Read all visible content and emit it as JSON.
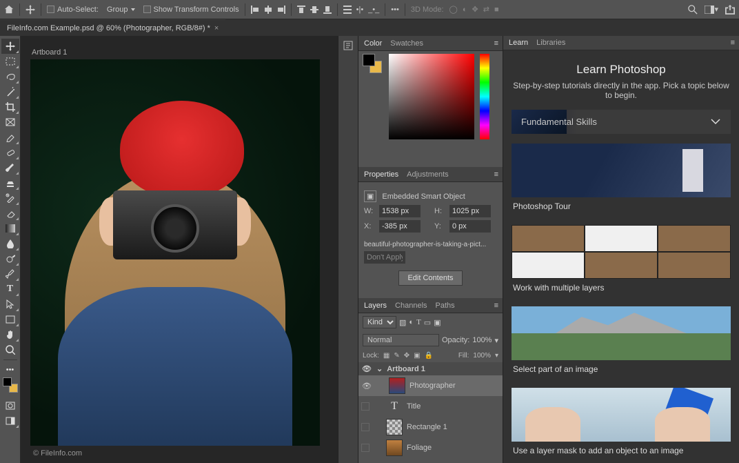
{
  "topbar": {
    "auto_select_label": "Auto-Select:",
    "auto_select_value": "Group",
    "transform_label": "Show Transform Controls",
    "mode3d_label": "3D Mode:"
  },
  "document": {
    "tab_title": "FileInfo.com Example.psd @ 60% (Photographer, RGB/8#) *",
    "artboard_label": "Artboard 1",
    "credit": "© FileInfo.com"
  },
  "color_panel": {
    "tabs": [
      "Color",
      "Swatches"
    ]
  },
  "properties_panel": {
    "tabs": [
      "Properties",
      "Adjustments"
    ],
    "object_type": "Embedded Smart Object",
    "w_label": "W:",
    "w_value": "1538 px",
    "h_label": "H:",
    "h_value": "1025 px",
    "x_label": "X:",
    "x_value": "-385 px",
    "y_label": "Y:",
    "y_value": "0 px",
    "filename": "beautiful-photographer-is-taking-a-pict...",
    "layer_comp": "Don't Apply Layer Comp",
    "edit_btn": "Edit Contents"
  },
  "layers_panel": {
    "tabs": [
      "Layers",
      "Channels",
      "Paths"
    ],
    "kind_label": "Kind",
    "blend_mode": "Normal",
    "opacity_label": "Opacity:",
    "opacity_value": "100%",
    "lock_label": "Lock:",
    "fill_label": "Fill:",
    "fill_value": "100%",
    "layers": [
      {
        "name": "Artboard 1",
        "type": "artboard"
      },
      {
        "name": "Photographer",
        "type": "smart",
        "selected": true,
        "visible": true
      },
      {
        "name": "Title",
        "type": "text"
      },
      {
        "name": "Rectangle 1",
        "type": "shape"
      },
      {
        "name": "Foliage",
        "type": "image"
      }
    ]
  },
  "learn": {
    "tabs": [
      "Learn",
      "Libraries"
    ],
    "title": "Learn Photoshop",
    "subtitle": "Step-by-step tutorials directly in the app. Pick a topic below to begin.",
    "section": "Fundamental Skills",
    "cards": [
      "Photoshop Tour",
      "Work with multiple layers",
      "Select part of an image",
      "Use a layer mask to add an object to an image"
    ]
  }
}
